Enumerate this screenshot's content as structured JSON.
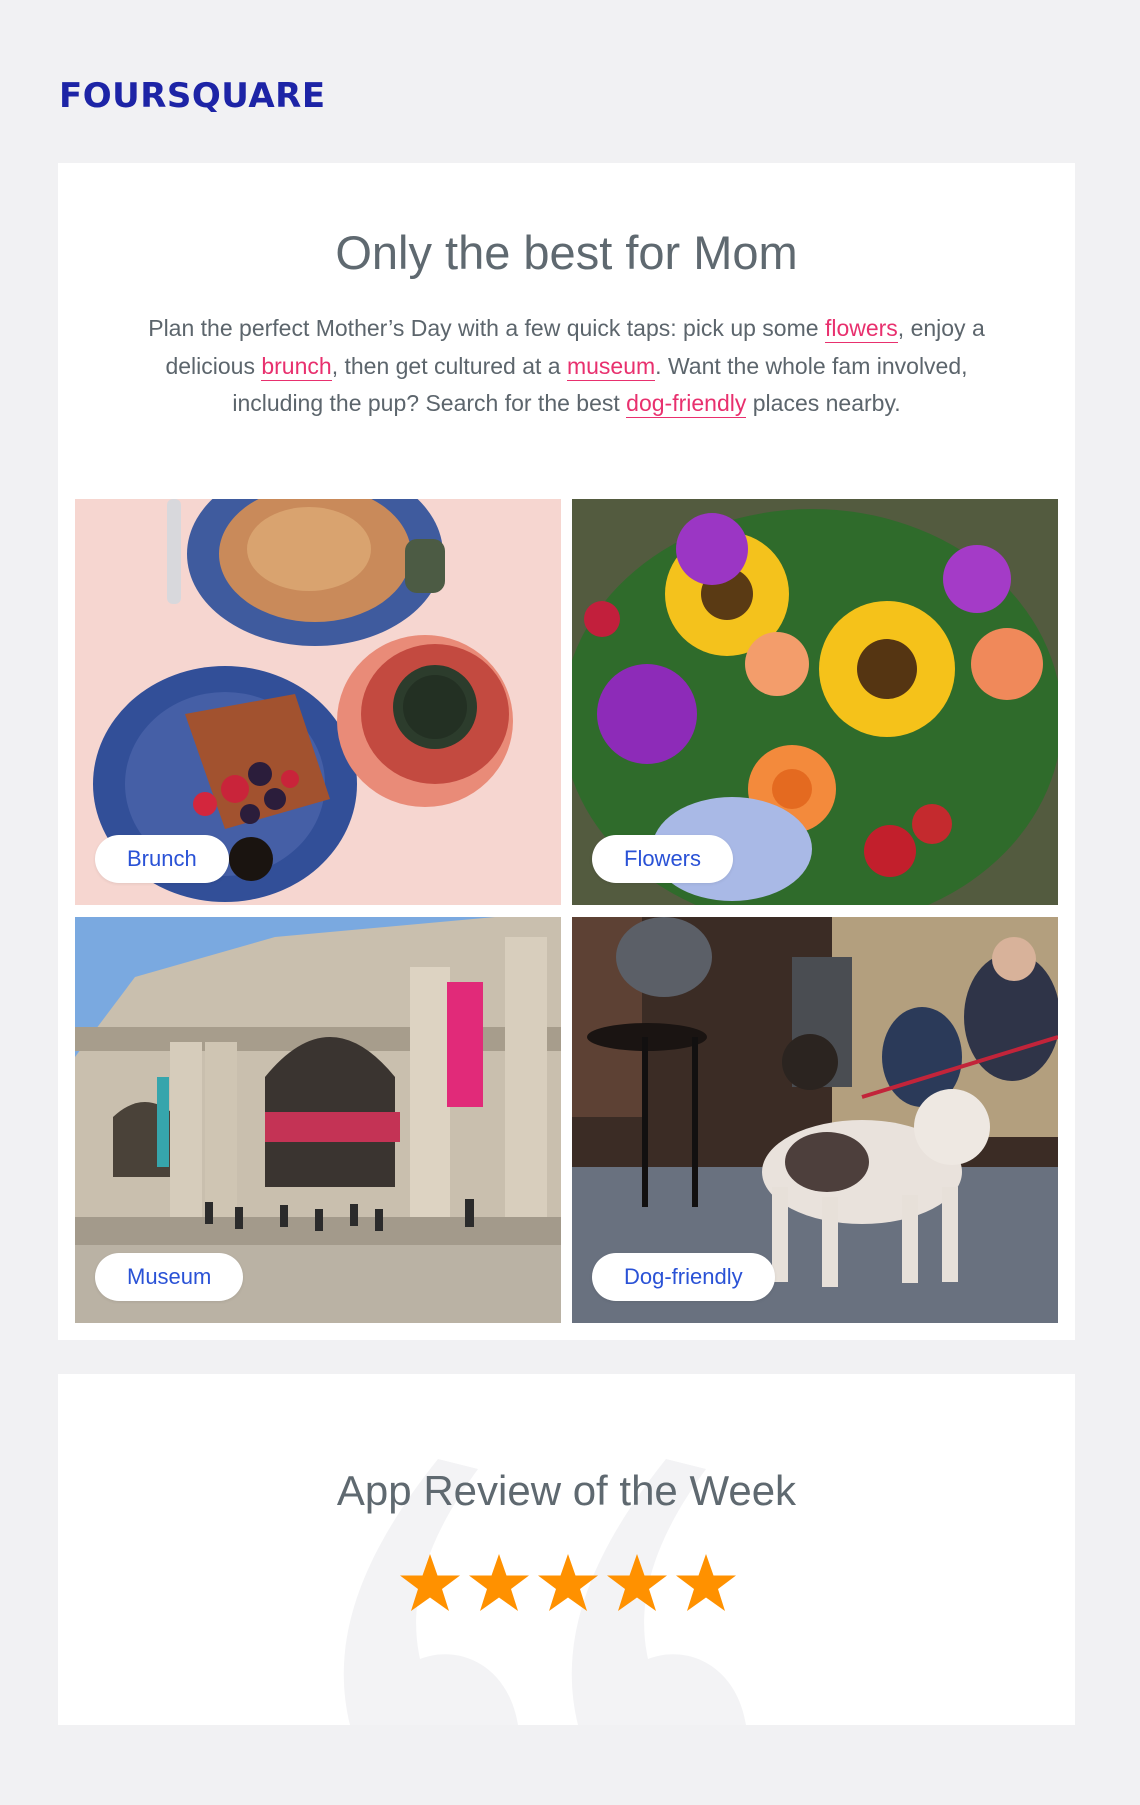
{
  "brand": {
    "logo_text": "FOURSQUARE",
    "color": "#1d24a6"
  },
  "hero": {
    "title": "Only the best for Mom",
    "intro": {
      "t1": "Plan the perfect Mother’s Day with a few quick taps: pick up some ",
      "link_flowers": "flowers",
      "t2": ", enjoy a delicious ",
      "link_brunch": "brunch",
      "t3": ", then get cultured at a ",
      "link_museum": "museum",
      "t4": ". Want the whole fam involved, including the pup? Search for the best ",
      "link_dog": "dog-friendly",
      "t5": " places nearby."
    },
    "link_color": "#e8306e"
  },
  "tiles": [
    {
      "label": "Brunch",
      "image": "brunch-photo"
    },
    {
      "label": "Flowers",
      "image": "flowers-photo"
    },
    {
      "label": "Museum",
      "image": "museum-photo"
    },
    {
      "label": "Dog-friendly",
      "image": "dog-friendly-photo"
    }
  ],
  "review": {
    "title": "App Review of the Week",
    "rating": 5,
    "max_rating": 5,
    "star_color": "#ff9100",
    "background_icon": "quote-mark-icon"
  }
}
